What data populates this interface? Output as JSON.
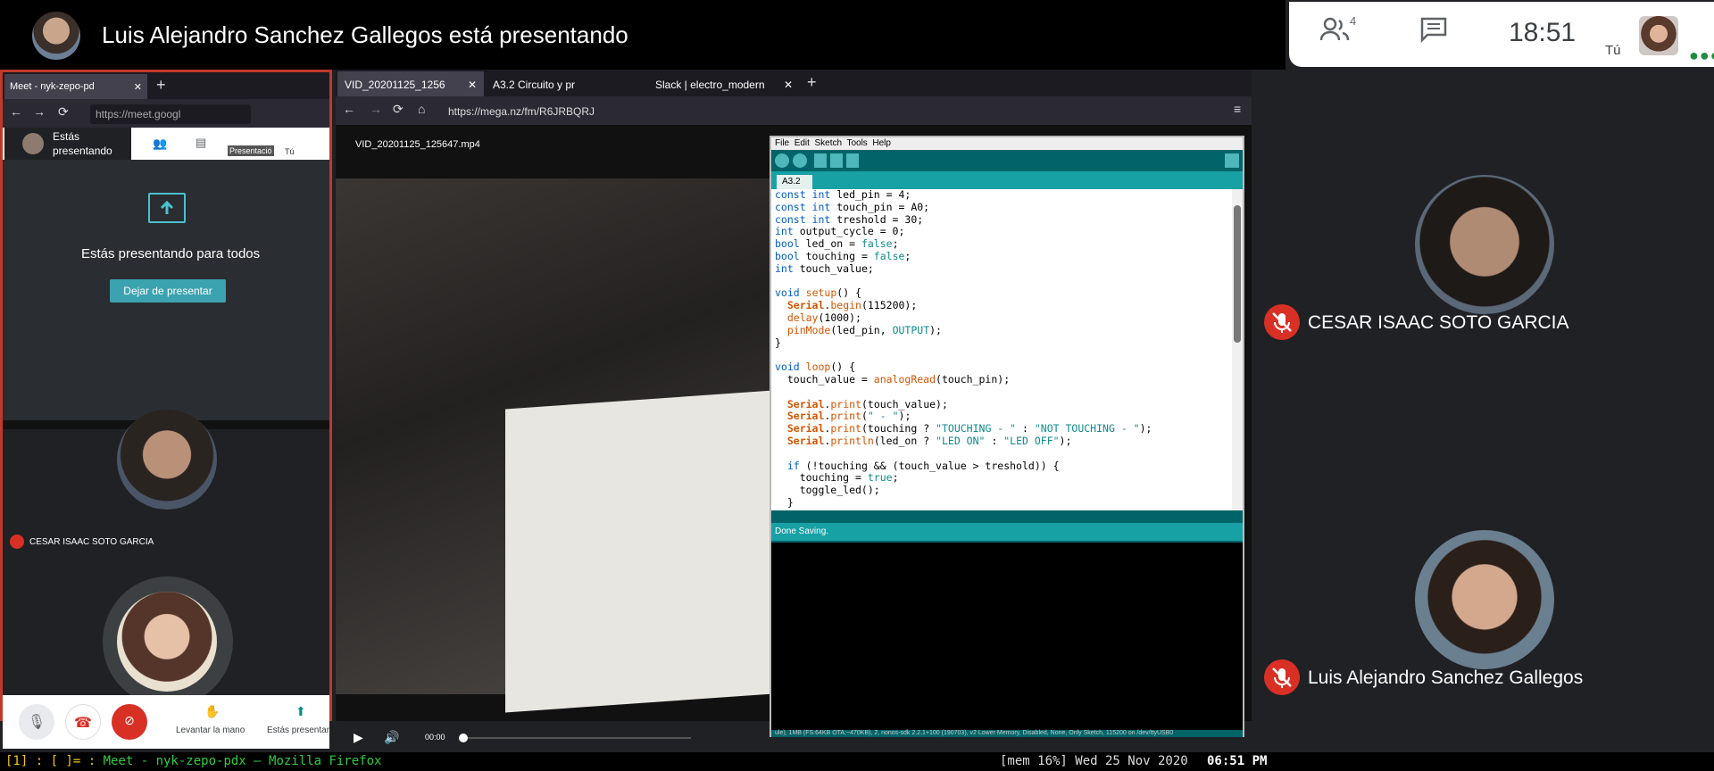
{
  "banner": {
    "presenter_text": "Luis Alejandro Sanchez Gallegos está presentando"
  },
  "controls": {
    "people_count": "4",
    "time": "18:51",
    "me_label": "Tú"
  },
  "left_pane": {
    "tab_title": "Meet - nyk-zepo-pd",
    "url": "https://meet.googl",
    "presenting_label": "Estás presentando",
    "sharing_message": "Estás presentando para todos",
    "stop_button": "Dejar de presentar",
    "participant_name": "CESAR ISAAC SOTO GARCIA",
    "mini_presentation": "Presentació",
    "mini_tu": "Tú",
    "raise_hand": "Levantar la mano",
    "presenting_short": "Estás presentan"
  },
  "firefox": {
    "tabs": [
      "VID_20201125_1256",
      "A3.2 Circuito y pr",
      "Slack | electro_modern"
    ],
    "url": "https://mega.nz/fm/R6JRBQRJ",
    "video_name": "VID_20201125_125647.mp4",
    "time_display": "00:00"
  },
  "arduino": {
    "menu": [
      "File",
      "Edit",
      "Sketch",
      "Tools",
      "Help"
    ],
    "tab": "A3.2",
    "status": "Done Saving.",
    "footer": "ule), 1MB (FS:64KB OTA:~470KB), 2, nonos-sdk 2.2.1+100 (190703), v2 Lower Memory, Disabled, None, Only Sketch, 115200 on /dev/ttyUSB0"
  },
  "right_panel": {
    "participants": [
      {
        "name": "CESAR ISAAC SOTO GARCIA"
      },
      {
        "name": "Luis Alejandro Sanchez Gallegos"
      }
    ]
  },
  "statusline": {
    "left_prefix": "[1] : [ ]= : ",
    "window_title": "Meet - nyk-zepo-pdx — Mozilla Firefox",
    "right_text": "[mem 16%] Wed 25 Nov 2020",
    "clock": "06:51 PM"
  },
  "colors": {
    "mute_red": "#d93025",
    "arduino_teal": "#006468",
    "arduino_light": "#17a1a5",
    "status_green": "#2ecc40"
  },
  "icons": [
    "people-icon",
    "chat-icon",
    "mic-off-icon",
    "hangup-icon",
    "camera-off-icon",
    "hand-icon",
    "present-icon"
  ]
}
